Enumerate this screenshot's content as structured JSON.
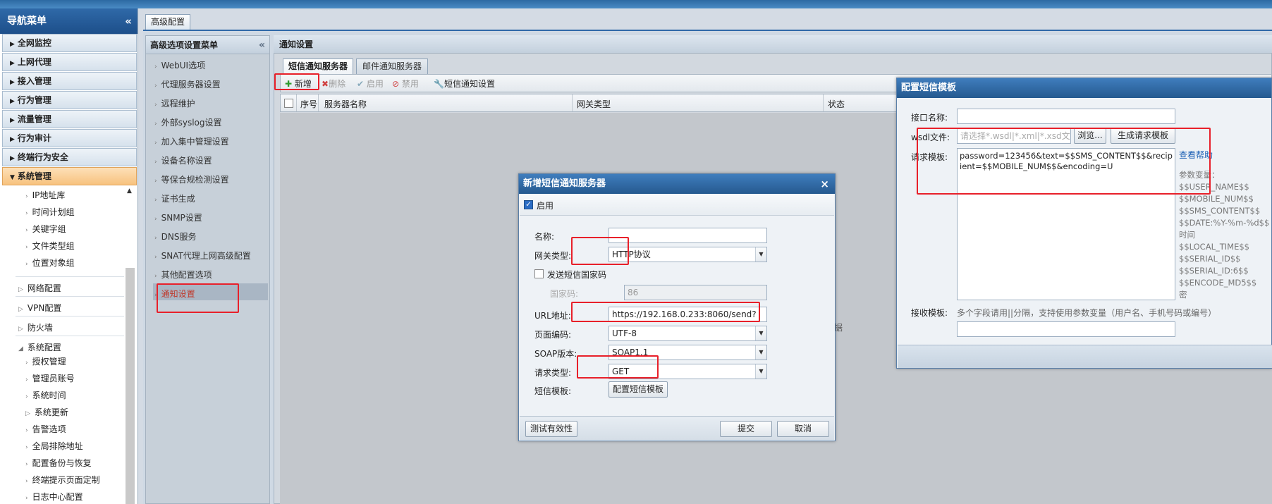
{
  "nav": {
    "title": "导航菜单",
    "collapse": "«",
    "items": [
      "全网监控",
      "上网代理",
      "接入管理",
      "行为管理",
      "流量管理",
      "行为审计",
      "终端行为安全",
      "系统管理"
    ],
    "sub_items_a": [
      "IP地址库",
      "时间计划组",
      "关键字组",
      "文件类型组",
      "位置对象组"
    ],
    "groups": [
      "网络配置",
      "VPN配置",
      "防火墙",
      "系统配置"
    ],
    "sub_items_b": [
      "授权管理",
      "管理员账号",
      "系统时间",
      "系统更新",
      "告警选项",
      "全局排除地址",
      "配置备份与恢复",
      "终端提示页面定制",
      "日志中心配置"
    ]
  },
  "main_tab": "高级配置",
  "side2": {
    "title": "高级选项设置菜单",
    "collapse": "«",
    "items": [
      "WebUI选项",
      "代理服务器设置",
      "远程维护",
      "外部syslog设置",
      "加入集中管理设置",
      "设备名称设置",
      "等保合规检测设置",
      "证书生成",
      "SNMP设置",
      "DNS服务",
      "SNAT代理上网高级配置",
      "其他配置选项",
      "通知设置"
    ]
  },
  "content": {
    "title": "通知设置",
    "tabs": [
      "短信通知服务器",
      "邮件通知服务器"
    ],
    "toolbar": {
      "new": "新增",
      "delete": "删除",
      "enable": "启用",
      "disable": "禁用",
      "sms_settings": "短信通知设置"
    },
    "columns": {
      "seq": "序号",
      "server_name": "服务器名称",
      "gateway_type": "网关类型",
      "status": "状态"
    },
    "stray_char": "据"
  },
  "dialog1": {
    "title": "新增短信通知服务器",
    "close": "×",
    "enable_label": "启用",
    "name_label": "名称:",
    "name_value": "",
    "gateway_label": "网关类型:",
    "gateway_value": "HTTP协议",
    "send_country_label": "发送短信国家码",
    "country_label": "国家码:",
    "country_value": "86",
    "url_label": "URL地址:",
    "url_value": "https://192.168.0.233:8060/send?",
    "encoding_label": "页面编码:",
    "encoding_value": "UTF-8",
    "soap_label": "SOAP版本:",
    "soap_value": "SOAP1.1",
    "request_type_label": "请求类型:",
    "request_type_value": "GET",
    "template_label": "短信模板:",
    "template_button": "配置短信模板",
    "test_button": "测试有效性",
    "submit_button": "提交",
    "cancel_button": "取消"
  },
  "dialog2": {
    "title": "配置短信模板",
    "interface_label": "接口名称:",
    "interface_value": "",
    "wsdl_label": "wsdl文件:",
    "wsdl_placeholder": "请选择*.wsdl|*.xml|*.xsd文件",
    "browse_button": "浏览...",
    "gen_button": "生成请求模板",
    "request_label": "请求模板:",
    "request_value": "password=123456&text=$$SMS_CONTENT$$&recipient=$$MOBILE_NUM$$&encoding=U",
    "help_link": "查看帮助",
    "params_title": "参数变量：",
    "params": [
      "$$USER_NAME$$",
      "$$MOBILE_NUM$$",
      "$$SMS_CONTENT$$",
      "$$DATE:%Y-%m-%d$$",
      "时间",
      "$$LOCAL_TIME$$",
      "$$SERIAL_ID$$",
      "$$SERIAL_ID:6$$",
      "$$ENCODE_MD5$$",
      "密"
    ],
    "receive_label": "接收模板:",
    "receive_hint": "多个字段请用||分隔，支持使用参数变量（用户名、手机号码或编号）",
    "receive_value": ""
  },
  "colors": {
    "nav_header": "#2f69a8",
    "active_nav": "#f7c27e",
    "annotation_red": "#e8202a",
    "link_blue": "#1a5fb4"
  }
}
